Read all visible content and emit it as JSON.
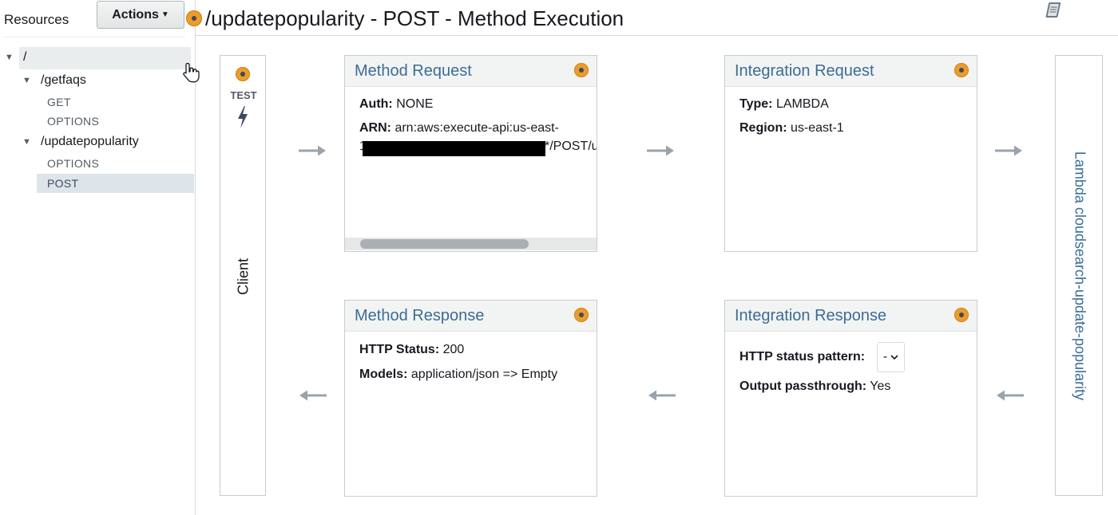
{
  "sidebar": {
    "resources_label": "Resources",
    "actions_label": "Actions",
    "tree": {
      "root": "/",
      "getfaqs": {
        "path": "/getfaqs",
        "methods": [
          "GET",
          "OPTIONS"
        ]
      },
      "updatepopularity": {
        "path": "/updatepopularity",
        "methods": [
          "OPTIONS",
          "POST"
        ],
        "selected": "POST"
      }
    }
  },
  "header": {
    "title": "/updatepopularity - POST - Method Execution"
  },
  "client": {
    "test_label": "TEST",
    "label": "Client"
  },
  "method_request": {
    "title": "Method Request",
    "auth_key": "Auth:",
    "auth_value": "NONE",
    "arn_key": "ARN:",
    "arn_value_line1": "arn:aws:execute-api:us-east-",
    "arn_prefix_char": "1",
    "arn_suffix": "*/POST/u"
  },
  "integration_request": {
    "title": "Integration Request",
    "type_key": "Type:",
    "type_value": "LAMBDA",
    "region_key": "Region:",
    "region_value": "us-east-1"
  },
  "method_response": {
    "title": "Method Response",
    "status_key": "HTTP Status:",
    "status_value": "200",
    "models_key": "Models:",
    "models_value": "application/json => Empty"
  },
  "integration_response": {
    "title": "Integration Response",
    "pattern_key": "HTTP status pattern:",
    "pattern_value": "-",
    "passthrough_key": "Output passthrough:",
    "passthrough_value": "Yes"
  },
  "lambda": {
    "label": "Lambda cloudsearch-update-popularity"
  },
  "colors": {
    "accent_orange": "#ec9c2b",
    "link_blue": "#3b6c97",
    "arrow_gray": "#9aa3ab"
  }
}
